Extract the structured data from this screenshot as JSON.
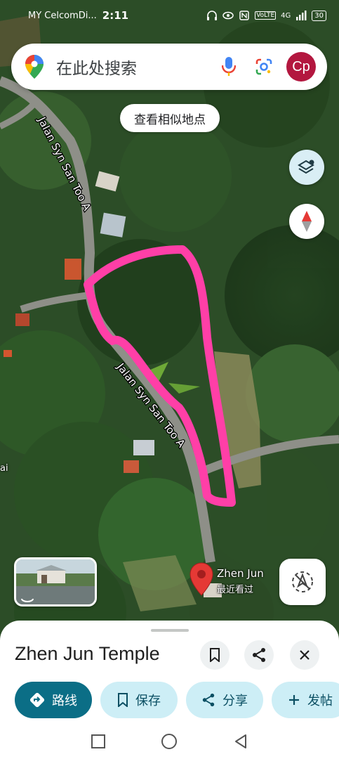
{
  "status_bar": {
    "carrier": "MY CelcomDi...",
    "time": "2:11",
    "network": "VoLTE",
    "signal": "4G",
    "battery": "30"
  },
  "search": {
    "placeholder": "在此处搜索",
    "avatar_initials": "Cp",
    "icons": [
      "maps-pin-icon",
      "mic-icon",
      "lens-icon"
    ]
  },
  "similar_places_label": "查看相似地点",
  "map": {
    "road_labels": [
      "Jalan Syn San Too A",
      "Jalan Syn San Too A"
    ],
    "edge_label": "ai",
    "place_pin": {
      "name": "Zhen Jun",
      "subtitle": "最近看过"
    },
    "controls": [
      "layers-icon",
      "compass-icon",
      "my-location-icon"
    ]
  },
  "sheet": {
    "title": "Zhen Jun Temple",
    "actions": {
      "directions": "路线",
      "save": "保存",
      "share": "分享",
      "post": "发帖"
    }
  },
  "colors": {
    "primary_chip": "#0b6e86",
    "secondary_chip": "#cdeef6",
    "annotation": "#ff3fa7",
    "pin": "#e53935"
  }
}
